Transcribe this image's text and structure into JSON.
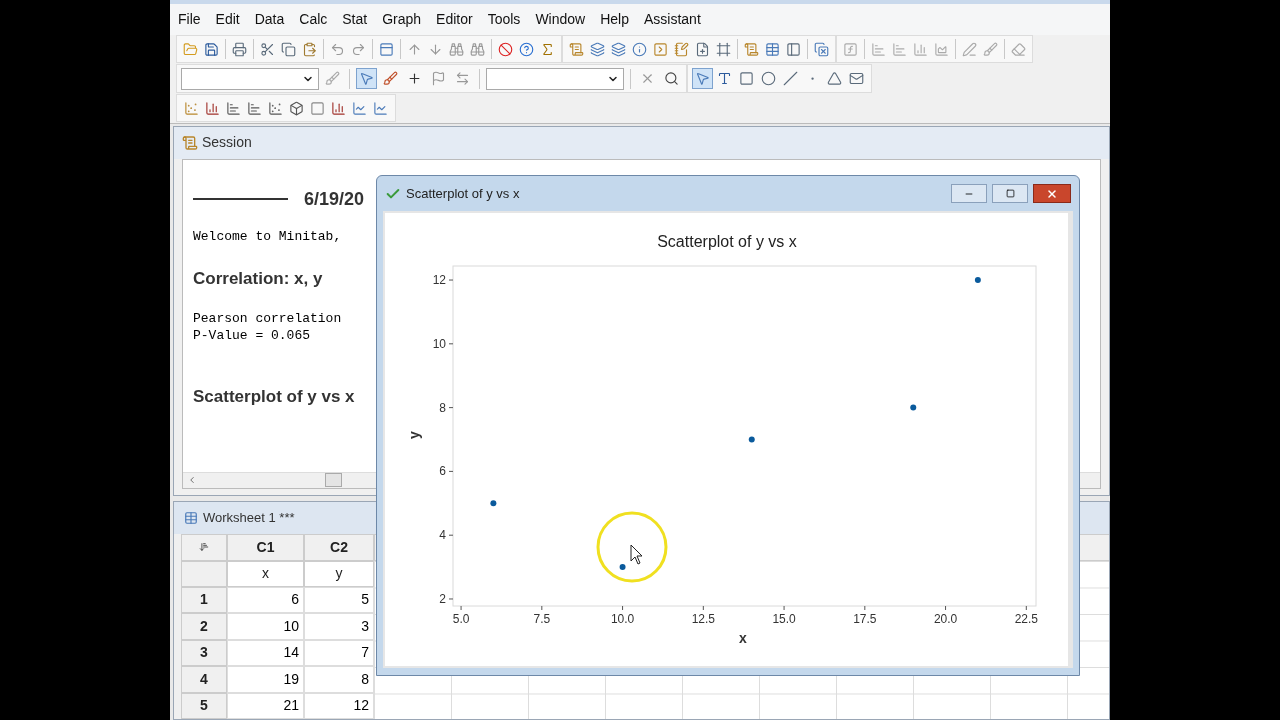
{
  "menu": [
    "File",
    "Edit",
    "Data",
    "Calc",
    "Stat",
    "Graph",
    "Editor",
    "Tools",
    "Window",
    "Help",
    "Assistant"
  ],
  "session": {
    "title": "Session",
    "date": "6/19/20",
    "welcome": "Welcome to Minitab,",
    "sections": [
      {
        "kind": "heading",
        "text": "Correlation: x, y"
      },
      {
        "kind": "output",
        "lines": [
          "Pearson correlation",
          "P-Value = 0.065"
        ]
      },
      {
        "kind": "heading",
        "text": "Scatterplot of y vs x"
      }
    ]
  },
  "worksheet": {
    "title": "Worksheet 1 ***",
    "columns": [
      {
        "id": "C1",
        "name": "x"
      },
      {
        "id": "C2",
        "name": "y"
      }
    ],
    "rows": [
      {
        "number": "1",
        "cells": [
          "6",
          "5"
        ]
      },
      {
        "number": "2",
        "cells": [
          "10",
          "3"
        ]
      },
      {
        "number": "3",
        "cells": [
          "14",
          "7"
        ]
      },
      {
        "number": "4",
        "cells": [
          "19",
          "8"
        ]
      },
      {
        "number": "5",
        "cells": [
          "21",
          "12"
        ]
      }
    ]
  },
  "graph_window": {
    "title": "Scatterplot of y vs x",
    "chart_data": {
      "type": "scatter",
      "title": "Scatterplot of y vs x",
      "xlabel": "x",
      "ylabel": "y",
      "x": [
        6,
        10,
        14,
        19,
        21
      ],
      "series": [
        {
          "color": "#0a5a9c",
          "values": [
            5,
            3,
            7,
            8,
            12
          ]
        }
      ],
      "xlim": [
        4.75,
        22.8
      ],
      "ylim": [
        1.78,
        12.44
      ],
      "xticks": [
        {
          "value": 5,
          "label": "5.0"
        },
        {
          "value": 7.5,
          "label": "7.5"
        },
        {
          "value": 10,
          "label": "10.0"
        },
        {
          "value": 12.5,
          "label": "12.5"
        },
        {
          "value": 15,
          "label": "15.0"
        },
        {
          "value": 17.5,
          "label": "17.5"
        },
        {
          "value": 20,
          "label": "20.0"
        },
        {
          "value": 22.5,
          "label": "22.5"
        }
      ],
      "yticks": [
        {
          "value": 2,
          "label": "2"
        },
        {
          "value": 4,
          "label": "4"
        },
        {
          "value": 6,
          "label": "6"
        },
        {
          "value": 8,
          "label": "8"
        },
        {
          "value": 10,
          "label": "10"
        },
        {
          "value": 12,
          "label": "12"
        }
      ]
    }
  }
}
